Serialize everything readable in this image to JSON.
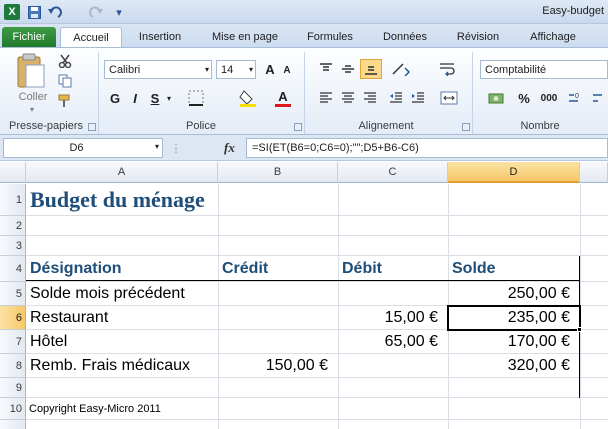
{
  "window": {
    "title": "Easy-budget"
  },
  "ribbon": {
    "tabs": [
      "Fichier",
      "Accueil",
      "Insertion",
      "Mise en page",
      "Formules",
      "Données",
      "Révision",
      "Affichage"
    ],
    "active_tab": "Accueil",
    "clipboard": {
      "paste_label": "Coller",
      "group_label": "Presse-papiers"
    },
    "font": {
      "name": "Calibri",
      "size": "14",
      "bold": "G",
      "italic": "I",
      "underline": "S",
      "grow": "A",
      "shrink": "A",
      "color_letter": "A",
      "group_label": "Police"
    },
    "alignment": {
      "group_label": "Alignement"
    },
    "number": {
      "format": "Comptabilité",
      "group_label": "Nombre",
      "percent": "%",
      "thousands": "000"
    }
  },
  "formula_bar": {
    "cell_ref": "D6",
    "fx": "fx",
    "formula": "=SI(ET(B6=0;C6=0);\"\";D5+B6-C6)"
  },
  "sheet": {
    "columns": [
      "A",
      "B",
      "C",
      "D"
    ],
    "rows": [
      "1",
      "2",
      "3",
      "4",
      "5",
      "6",
      "7",
      "8",
      "9",
      "10"
    ],
    "selected_cell": "D6",
    "title": "Budget du ménage",
    "headers": {
      "designation": "Désignation",
      "credit": "Crédit",
      "debit": "Débit",
      "solde": "Solde"
    },
    "data_rows": [
      {
        "designation": "Solde mois précédent",
        "credit": "",
        "debit": "",
        "solde": "250,00 €"
      },
      {
        "designation": "Restaurant",
        "credit": "",
        "debit": "15,00 €",
        "solde": "235,00 €"
      },
      {
        "designation": "Hôtel",
        "credit": "",
        "debit": "65,00 €",
        "solde": "170,00 €"
      },
      {
        "designation": "Remb. Frais médicaux",
        "credit": "150,00 €",
        "debit": "",
        "solde": "320,00 €"
      }
    ],
    "footer": "Copyright Easy-Micro 2011"
  },
  "colors": {
    "title_blue": "#1f4e79",
    "selection": "#f7c767",
    "file_tab": "#2a8a35"
  }
}
